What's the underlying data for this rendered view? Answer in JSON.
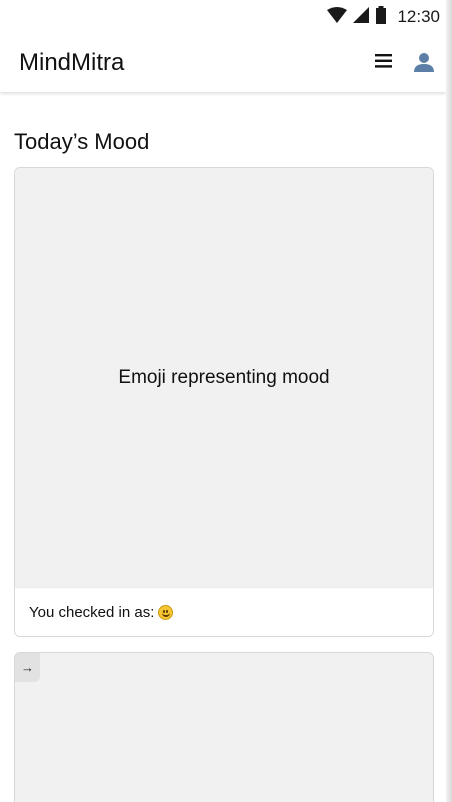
{
  "status_bar": {
    "time": "12:30",
    "icons": [
      "wifi-icon",
      "signal-icon",
      "battery-icon"
    ]
  },
  "app_bar": {
    "title": "MindMitra",
    "menu_icon": "menu-icon",
    "profile_icon": "profile-icon"
  },
  "mood_section": {
    "title": "Today’s Mood",
    "image_placeholder": "Emoji representing mood",
    "checked_in_label": "You checked in as:",
    "mood_emoji": "smiling-face-icon"
  },
  "second_card": {
    "arrow_label": "→"
  },
  "colors": {
    "background": "#ffffff",
    "card_image_bg": "#f1f1f1",
    "card_border": "#d8d8d8",
    "text": "#111111",
    "profile_icon": "#5b7fa6"
  }
}
